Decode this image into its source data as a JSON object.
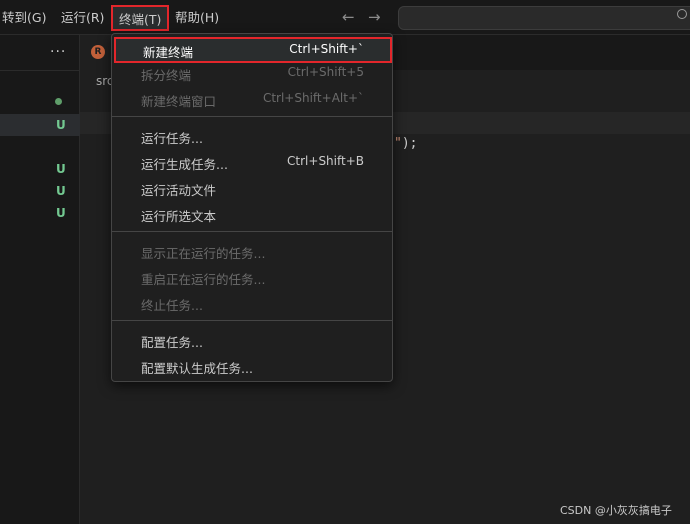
{
  "menubar": {
    "goto": "转到(G)",
    "run": "运行(R)",
    "terminal": "终端(T)",
    "help": "帮助(H)",
    "back_icon": "arrow-left",
    "forward_icon": "arrow-right"
  },
  "sidebar": {
    "more": "···",
    "badges": [
      "U",
      "U",
      "U",
      "U"
    ]
  },
  "editor": {
    "breadcrumb": "src",
    "tab_icon_letter": "R",
    "code_quote": "\"",
    "code_tail": ");"
  },
  "terminal_menu": {
    "new_terminal": {
      "label": "新建终端",
      "shortcut": "Ctrl+Shift+`"
    },
    "split_terminal": {
      "label": "拆分终端",
      "shortcut": "Ctrl+Shift+5"
    },
    "new_terminal_window": {
      "label": "新建终端窗口",
      "shortcut": "Ctrl+Shift+Alt+`"
    },
    "run_task": {
      "label": "运行任务..."
    },
    "run_build_task": {
      "label": "运行生成任务...",
      "shortcut": "Ctrl+Shift+B"
    },
    "run_active_file": {
      "label": "运行活动文件"
    },
    "run_selected_text": {
      "label": "运行所选文本"
    },
    "show_running_tasks": {
      "label": "显示正在运行的任务..."
    },
    "restart_running_task": {
      "label": "重启正在运行的任务..."
    },
    "terminate_task": {
      "label": "终止任务..."
    },
    "configure_tasks": {
      "label": "配置任务..."
    },
    "configure_default_build": {
      "label": "配置默认生成任务..."
    }
  },
  "watermark": "CSDN @小灰灰搞电子",
  "colors": {
    "highlight_border": "#e3262b",
    "untracked_badge": "#73c991",
    "string": "#ce9178"
  }
}
